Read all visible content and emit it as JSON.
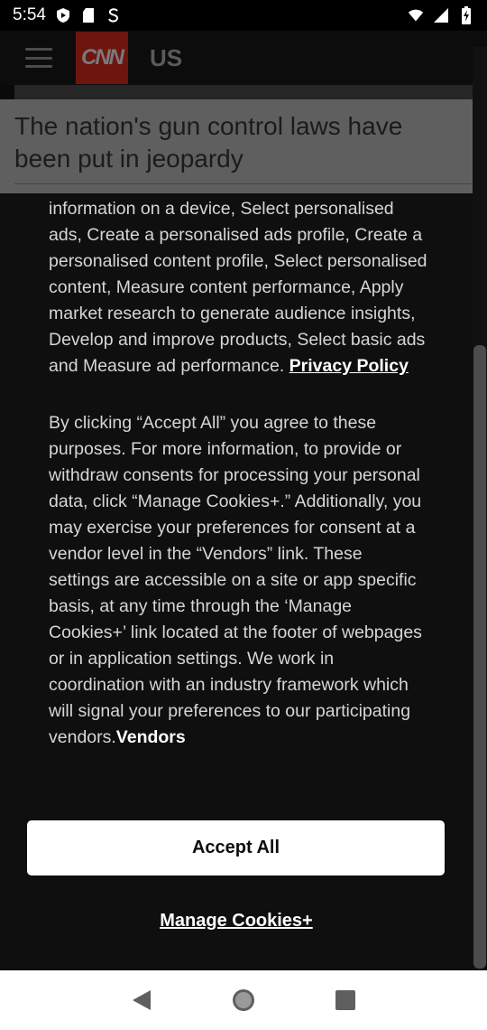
{
  "status": {
    "time": "5:54",
    "icons_left": [
      "shield-play-icon",
      "sd-card-icon",
      "s-app-icon"
    ],
    "icons_right": [
      "wifi-icon",
      "signal-icon",
      "battery-charging-icon"
    ]
  },
  "background": {
    "brand": "CNN",
    "edition": "US",
    "headline": "The nation's gun control laws have been put in jeopardy"
  },
  "consent": {
    "para1": "information on a device, Select personalised ads, Create a personalised ads profile, Create a personalised content profile, Select personalised content, Measure content performance, Apply market research to generate audience insights, Develop and improve products, Select basic ads and Measure ad performance.",
    "privacy_link": "Privacy Policy",
    "para2": "By clicking “Accept All” you agree to these purposes. For more information, to provide or withdraw consents for processing your personal data, click “Manage Cookies+.” Additionally, you may exercise your preferences for consent at a vendor level in the “Vendors” link. These settings are accessible on a site or app specific basis, at any time through the ‘Manage Cookies+’ link located at the footer of webpages or in application settings. We work in coordination with an industry framework which will signal your preferences to our participating vendors.",
    "vendors_link": "Vendors",
    "accept_label": "Accept All",
    "manage_label": "Manage Cookies+"
  },
  "nav": {
    "buttons": [
      "back-icon",
      "home-icon",
      "recents-icon"
    ]
  },
  "colors": {
    "sheet_bg": "#0f0f0f",
    "button_bg": "#ffffff",
    "cnn_red": "#cc0000"
  }
}
